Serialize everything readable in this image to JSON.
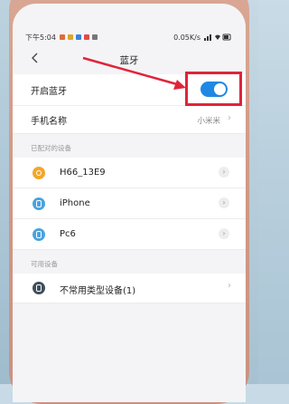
{
  "status_bar": {
    "time": "下午5:04",
    "network_speed": "0.05K/s"
  },
  "header": {
    "title": "蓝牙",
    "back_icon": "chevron-left-icon"
  },
  "settings": {
    "bluetooth_toggle": {
      "label": "开启蓝牙",
      "state": "on"
    },
    "device_name": {
      "label": "手机名称",
      "value": "小米米"
    }
  },
  "paired": {
    "section_title": "已配对的设备",
    "devices": [
      {
        "name": "H66_13E9",
        "icon": "headset-icon"
      },
      {
        "name": "iPhone",
        "icon": "phone-icon"
      },
      {
        "name": "Pc6",
        "icon": "phone-icon"
      }
    ]
  },
  "available": {
    "section_title": "可用设备",
    "devices": [
      {
        "name": "不常用类型设备(1)",
        "icon": "device-icon"
      }
    ]
  },
  "colors": {
    "toggle_on": "#1f88e5",
    "annotation": "#e0243a",
    "headset": "#f3a629",
    "phone": "#4aa3df"
  }
}
